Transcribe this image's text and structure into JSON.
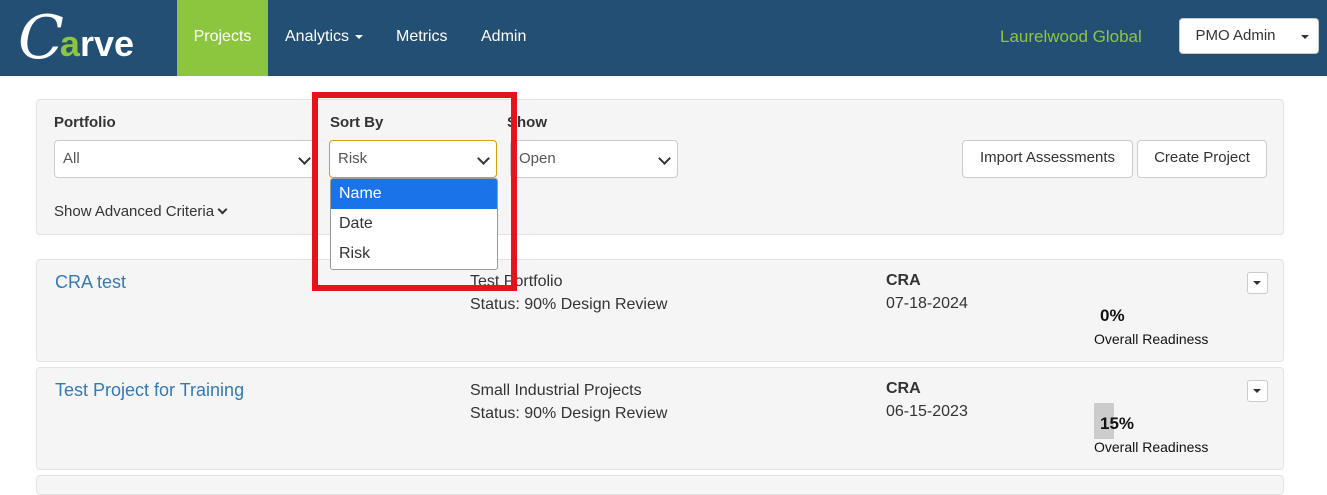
{
  "nav": {
    "logo_c": "C",
    "logo_a": "a",
    "logo_rest": "rve",
    "items": [
      {
        "label": "Projects",
        "active": true
      },
      {
        "label": "Analytics"
      },
      {
        "label": "Metrics"
      },
      {
        "label": "Admin"
      }
    ],
    "company": "Laurelwood Global",
    "user_label": "PMO Admin"
  },
  "filters": {
    "portfolio": {
      "label": "Portfolio",
      "value": "All"
    },
    "sort": {
      "label": "Sort By",
      "value": "Risk",
      "options": [
        "Name",
        "Date",
        "Risk"
      ],
      "highlighted": "Name"
    },
    "show": {
      "label": "Show",
      "value": "Open"
    },
    "import_label": "Import Assessments",
    "create_label": "Create Project",
    "advanced_label": "Show Advanced Criteria"
  },
  "projects": [
    {
      "name": "CRA test",
      "portfolio": "Test Portfolio",
      "status": "Status: 90% Design Review",
      "type": "CRA",
      "date": "07-18-2024",
      "readiness_percent": 0,
      "readiness_text": "0%",
      "readiness_label": "Overall Readiness"
    },
    {
      "name": "Test Project for Training",
      "portfolio": "Small Industrial Projects",
      "status": "Status: 90% Design Review",
      "type": "CRA",
      "date": "06-15-2023",
      "readiness_percent": 15,
      "readiness_text": "15%",
      "readiness_label": "Overall Readiness"
    }
  ],
  "colors": {
    "navbar": "#244f75",
    "accent_green": "#8cc63f",
    "link_blue": "#337ab7",
    "highlight_red": "#e3141b",
    "option_selected": "#1a73e8"
  }
}
